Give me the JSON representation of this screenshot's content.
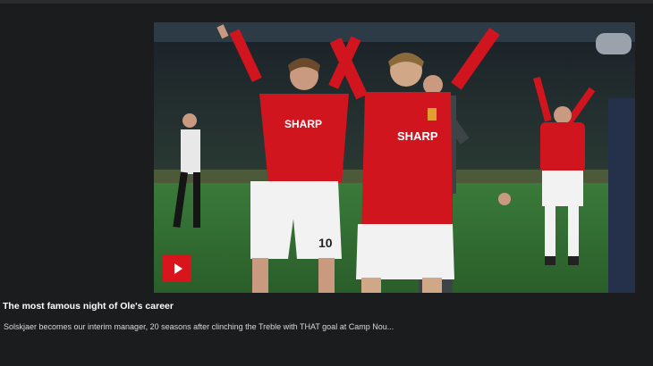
{
  "video": {
    "kit_sponsor": "SHARP",
    "shirt_number": "10",
    "play_icon": "play-icon"
  },
  "caption": {
    "title": "The most famous night of Ole's career",
    "description": "Solskjaer becomes our interim manager, 20 seasons after clinching the Treble with THAT goal at Camp Nou..."
  },
  "colors": {
    "page_background": "#1b1c1d",
    "kit_red": "#d0151f",
    "play_button": "#d8151c",
    "pitch_green": "#2f6a2f"
  }
}
